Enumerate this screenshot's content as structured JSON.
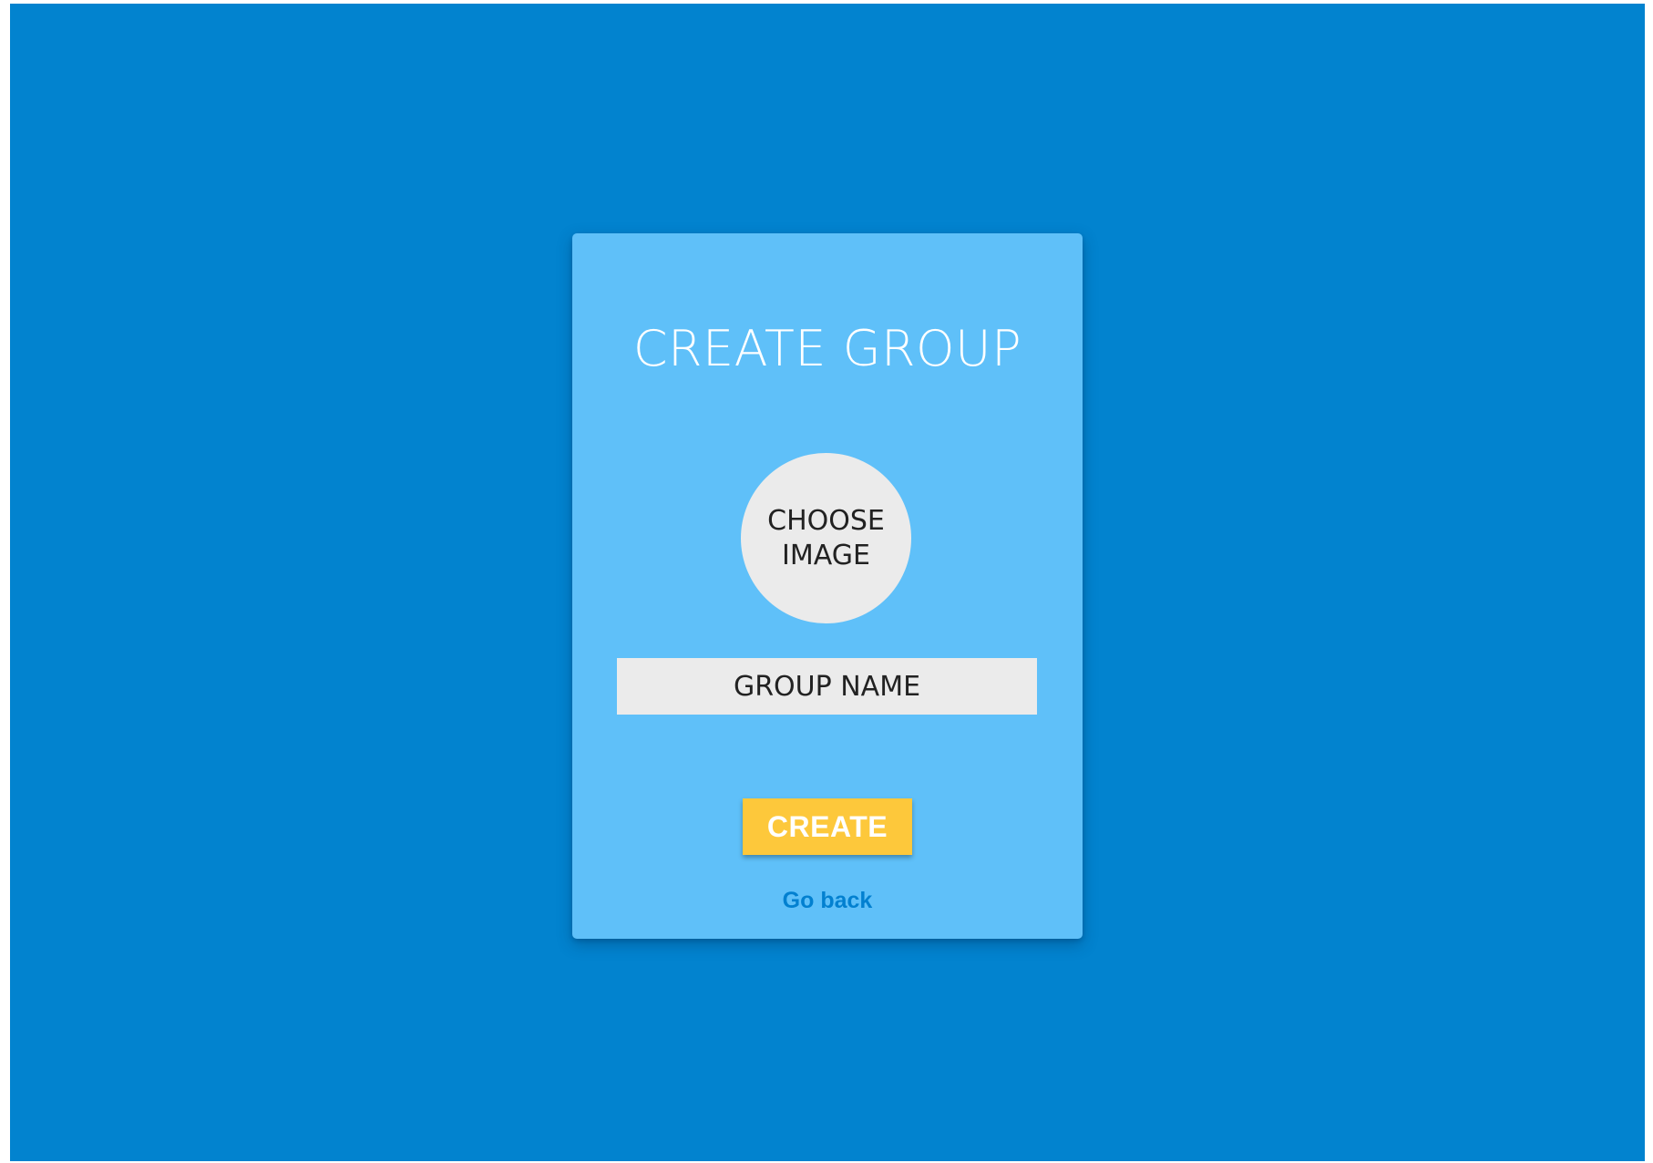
{
  "page": {
    "background_color": "#0283cf"
  },
  "card": {
    "background_color": "#5fc0f9",
    "title": "CREATE GROUP",
    "image_picker": {
      "label": "CHOOSE IMAGE",
      "background_color": "#ebebeb"
    },
    "group_name": {
      "placeholder": "GROUP NAME",
      "value": ""
    },
    "create_button": {
      "label": "CREATE",
      "background_color": "#fdc83b",
      "text_color": "#ffffff"
    },
    "go_back": {
      "label": "Go back",
      "color": "#0280d0"
    }
  }
}
